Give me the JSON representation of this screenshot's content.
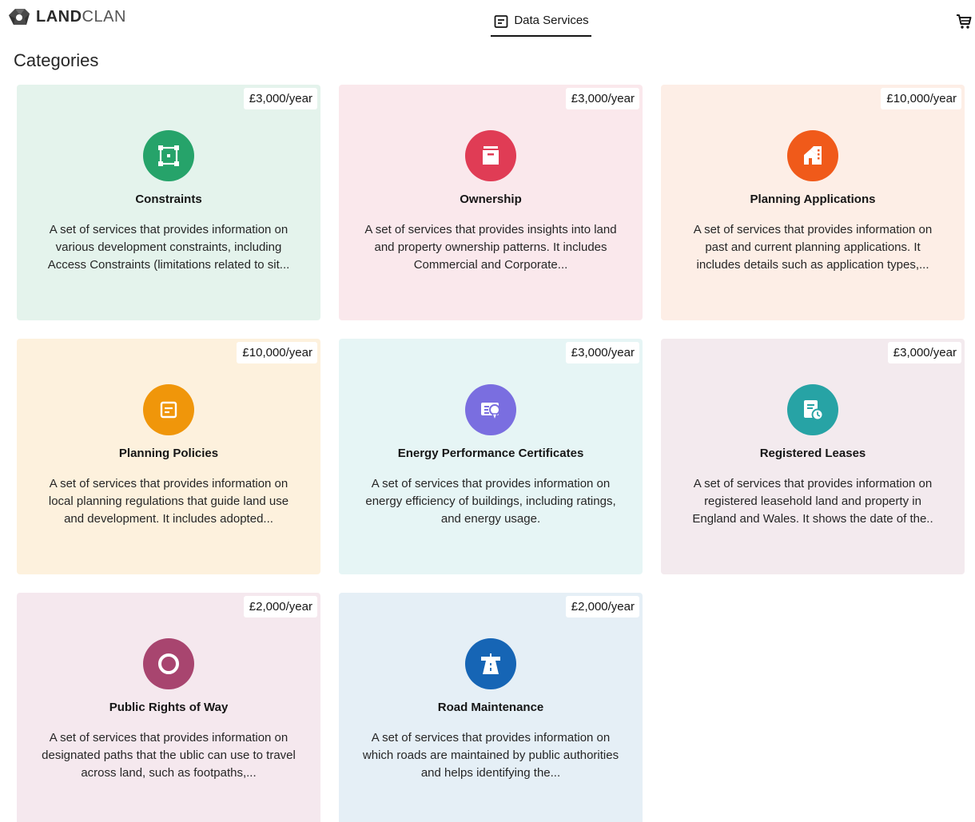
{
  "brand": {
    "name_bold": "LAND",
    "name_light": "CLAN"
  },
  "nav": {
    "data_services_label": "Data Services"
  },
  "page": {
    "heading": "Categories"
  },
  "colors": {
    "constraints_bg": "#e4f3ec",
    "constraints_icon": "#26a36a",
    "ownership_bg": "#fae8ec",
    "ownership_icon": "#e03c55",
    "planning_apps_bg": "#fdeee6",
    "planning_apps_icon": "#f05a1a",
    "planning_policies_bg": "#fdf1dd",
    "planning_policies_icon": "#f0960a",
    "epc_bg": "#e6f5f5",
    "epc_icon": "#7a6ee0",
    "leases_bg": "#f3eaee",
    "leases_icon": "#27a3a5",
    "prow_bg": "#f5e8ee",
    "prow_icon": "#a8456f",
    "roads_bg": "#e5eff6",
    "roads_icon": "#1665b5"
  },
  "cards": [
    {
      "price": "£3,000/year",
      "title": "Constraints",
      "icon": "select-box-icon",
      "desc": "A set of services that provides information on various development constraints, including Access Constraints (limitations related to sit..."
    },
    {
      "price": "£3,000/year",
      "title": "Ownership",
      "icon": "archive-box-icon",
      "desc": "A set of services that provides insights into land and property ownership patterns. It includes Commercial and Corporate..."
    },
    {
      "price": "£10,000/year",
      "title": "Planning Applications",
      "icon": "house-building-icon",
      "desc": "A set of services that provides information on past and current planning applications. It includes details such as application types,..."
    },
    {
      "price": "£10,000/year",
      "title": "Planning Policies",
      "icon": "document-list-icon",
      "desc": "A set of services that provides information on local planning regulations that guide land use and development. It includes adopted..."
    },
    {
      "price": "£3,000/year",
      "title": "Energy Performance Certificates",
      "icon": "certificate-badge-icon",
      "desc": "A set of services that provides information on energy efficiency of buildings, including ratings, and energy usage."
    },
    {
      "price": "£3,000/year",
      "title": "Registered Leases",
      "icon": "document-clock-icon",
      "desc": "A set of services that provides information on registered leasehold land and property in England and Wales. It shows the date of the.."
    },
    {
      "price": "£2,000/year",
      "title": "Public Rights of Way",
      "icon": "ring-icon",
      "desc": "A set of services that provides information on designated paths that the ublic can use to travel across land, such as footpaths,..."
    },
    {
      "price": "£2,000/year",
      "title": "Road Maintenance",
      "icon": "road-sign-icon",
      "desc": "A set of services that provides information on which roads are maintained by public authorities and helps identifying the..."
    }
  ]
}
